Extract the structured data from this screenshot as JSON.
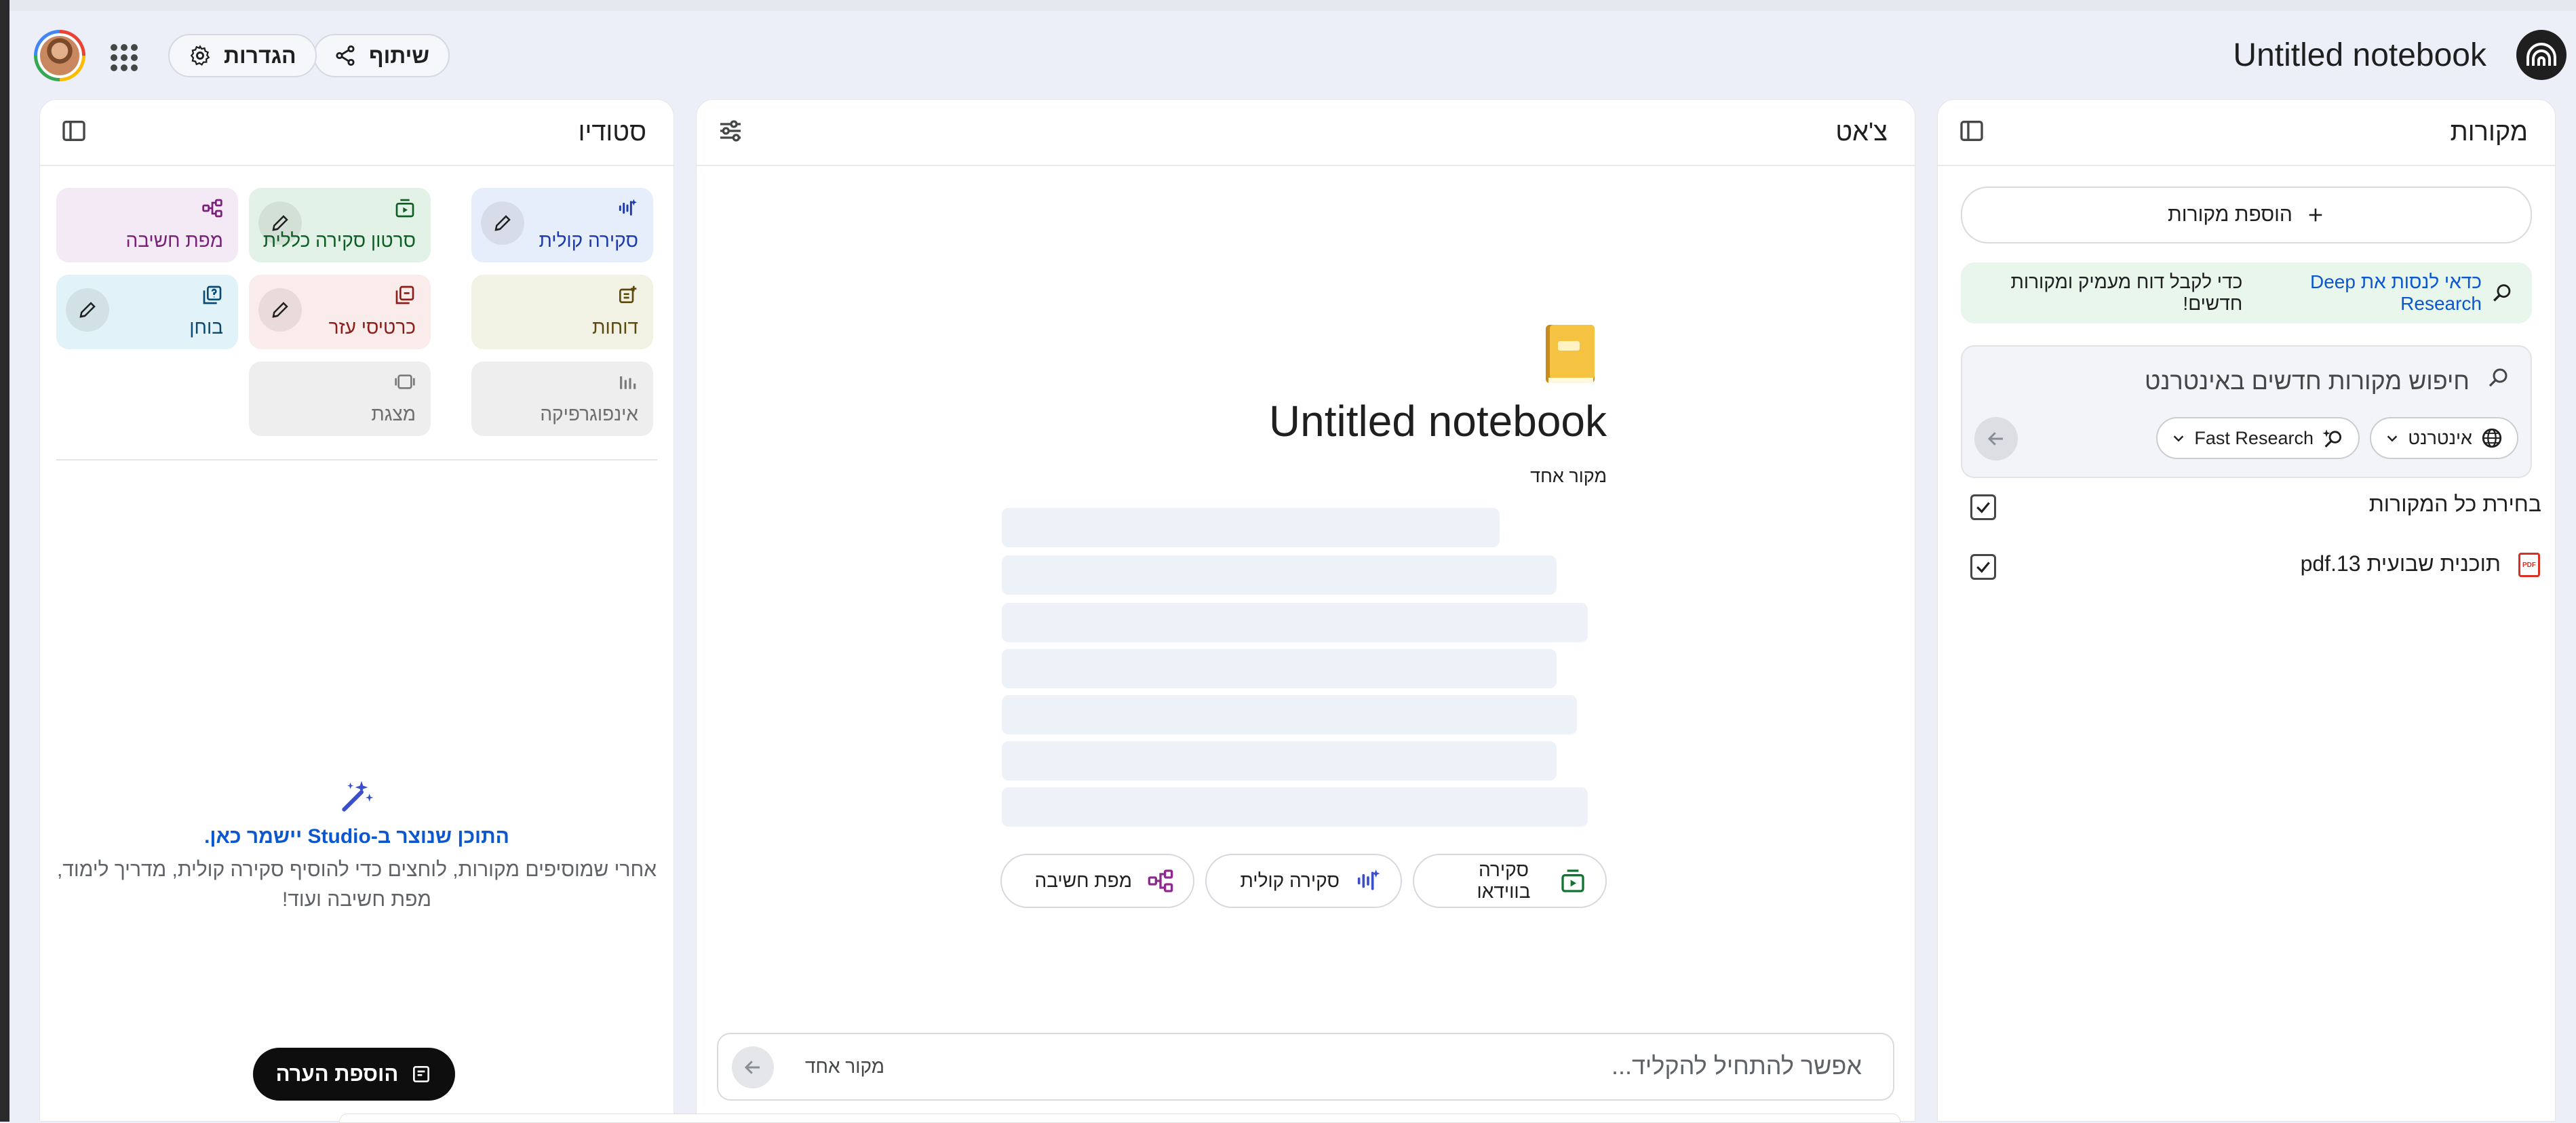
{
  "header": {
    "notebook_title": "Untitled notebook",
    "share_label": "שיתוף",
    "settings_label": "הגדרות"
  },
  "sources": {
    "title": "מקורות",
    "add_label": "הוספת מקורות",
    "tip_link": "כדאי לנסות את Deep Research",
    "tip_rest": "כדי לקבל דוח מעמיק ומקורות חדשים!",
    "search_placeholder": "חיפוש מקורות חדשים באינטרנט",
    "chip_web": "אינטרנט",
    "chip_research": "Fast Research",
    "select_all": "בחירת כל המקורות",
    "items": [
      {
        "name": "תוכנית שבועית 13.pdf",
        "checked": true
      }
    ]
  },
  "chat": {
    "title": "צ'אט",
    "notebook_title": "Untitled notebook",
    "source_count": "מקור אחד",
    "actions": {
      "video": "סקירה בווידאו",
      "audio": "סקירה קולית",
      "mindmap": "מפת חשיבה"
    },
    "input_placeholder": "אפשר להתחיל להקליד...",
    "input_source_count": "מקור אחד"
  },
  "studio": {
    "title": "סטודיו",
    "tiles": {
      "audio": "סקירה קולית",
      "video": "סרטון סקירה כללית",
      "mindmap": "מפת חשיבה",
      "reports": "דוחות",
      "flashcards": "כרטיסי עזר",
      "quiz": "בוחן",
      "infographic": "אינפוגרפיקה",
      "slides": "מצגת"
    },
    "empty_title": "התוכן שנוצר ב-Studio יישמר כאן.",
    "empty_line1": "אחרי שמוסיפים מקורות, לוחצים כדי להוסיף סקירה קולית, מדריך לימוד,",
    "empty_line2": "מפת חשיבה ועוד!",
    "add_note_label": "הוספת הערה"
  },
  "colors": {
    "background": "#eceff8",
    "accent_blue": "#0b57d0",
    "tile_audio": "#e7eefb",
    "tile_video": "#e3f2e6",
    "tile_mindmap": "#f4eaf5",
    "tile_reports": "#f2f2e4",
    "tile_flashcards": "#fbecec",
    "tile_quiz": "#e1f3f8",
    "tile_disabled": "#eeeeee"
  },
  "icons": {
    "logo": "notebooklm-logo-icon",
    "share": "share-icon",
    "settings": "gear-icon",
    "apps": "apps-grid-icon",
    "panel_toggle": "sidebar-toggle-icon",
    "tune": "tune-icon",
    "search": "search-icon"
  }
}
